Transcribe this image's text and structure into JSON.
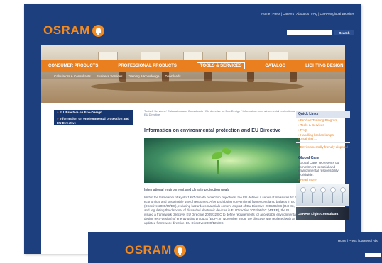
{
  "header": {
    "top_links": [
      "Home",
      "Press",
      "Careers",
      "About us",
      "FAQ",
      "OSRAM global websites"
    ],
    "logo_text": "OSRAM",
    "search_button": "Search",
    "search_placeholder": ""
  },
  "nav": {
    "items": [
      {
        "label": "CONSUMER PRODUCTS"
      },
      {
        "label": "PROFESSIONAL PRODUCTS"
      },
      {
        "label": "TOOLS & SERVICES",
        "active": true
      },
      {
        "label": "CATALOG"
      },
      {
        "label": "LIGHTING DESIGN"
      }
    ],
    "subitems": [
      "Calculators & Consultants",
      "Business Services",
      "Training & Knowledge",
      "Downloads"
    ]
  },
  "left_nav": {
    "items": [
      {
        "label": "EU directive on Eco-Design"
      },
      {
        "label": "Information on environmental protection and EU Directive"
      }
    ]
  },
  "main": {
    "breadcrumb": "Tools & Services / Calculators and Consultants / EU directive on Eco-Design / Information on environmental protection and EU Directive",
    "title": "Information on environmental protection and EU Directive",
    "subtitle": "International environment and climate protection goals",
    "body": "Within the framework of Kyoto 1997 climate protection objectives, the EU defined a series of measures for the economical and sustainable use of resources. After prohibiting conventional fluorescent lamp ballasts in EU (Directive 2000/55/EC), reducing hazardous materials content as part of EU Directive 2002/95/EC (RoHS), and regulating the disposal of discarded electronic devices in EU Directive 2002/96/EC (WEEE), the EU issued a framework directive, EU Directive 2005/32/EC to define requirements for acceptable environmental design (eco-design) of energy using products (EUP). In November 2008, the directive was replaced with an updated framework directive, EU Directive 2009/125/EC."
  },
  "right": {
    "quick_links_title": "Quick Links",
    "quick_links": [
      "Product Training Program",
      "Tools & Services",
      "FAQ",
      "Handling broken lamps containing ...",
      "Environmentally friendly disposal"
    ],
    "global_care_title": "Global Care",
    "global_care_text": "\"Global Care\" represents our commitment to social and environmental responsibility worldwide.",
    "global_care_link": "Read more",
    "consultant_label": "OSRAM Light Consultant"
  },
  "overlay": {
    "logo_text": "OSRAM",
    "top_links": [
      "Home",
      "Press",
      "Careers",
      "Abo"
    ]
  }
}
